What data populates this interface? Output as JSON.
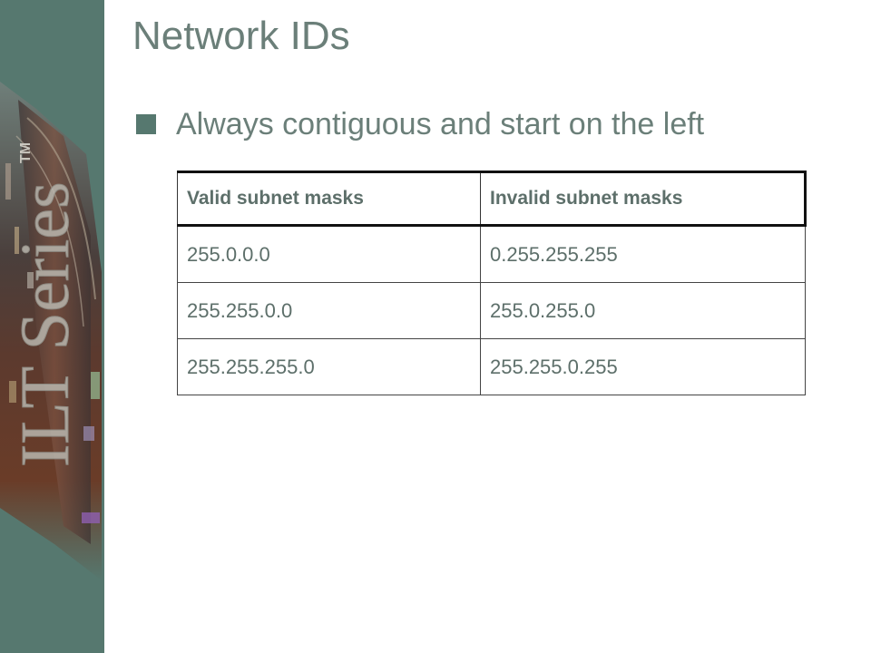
{
  "sidebar": {
    "brand": "ILT Series",
    "trademark": "TM"
  },
  "slide": {
    "title": "Network IDs",
    "bullet": "Always contiguous and start on the left"
  },
  "table": {
    "headers": [
      "Valid subnet masks",
      "Invalid subnet masks"
    ],
    "rows": [
      [
        "255.0.0.0",
        "0.255.255.255"
      ],
      [
        "255.255.0.0",
        "255.0.255.0"
      ],
      [
        "255.255.255.0",
        "255.255.0.255"
      ]
    ]
  },
  "colors": {
    "sidebar": "#56786f",
    "title": "#6b7f79",
    "bullet": "#56786f"
  }
}
